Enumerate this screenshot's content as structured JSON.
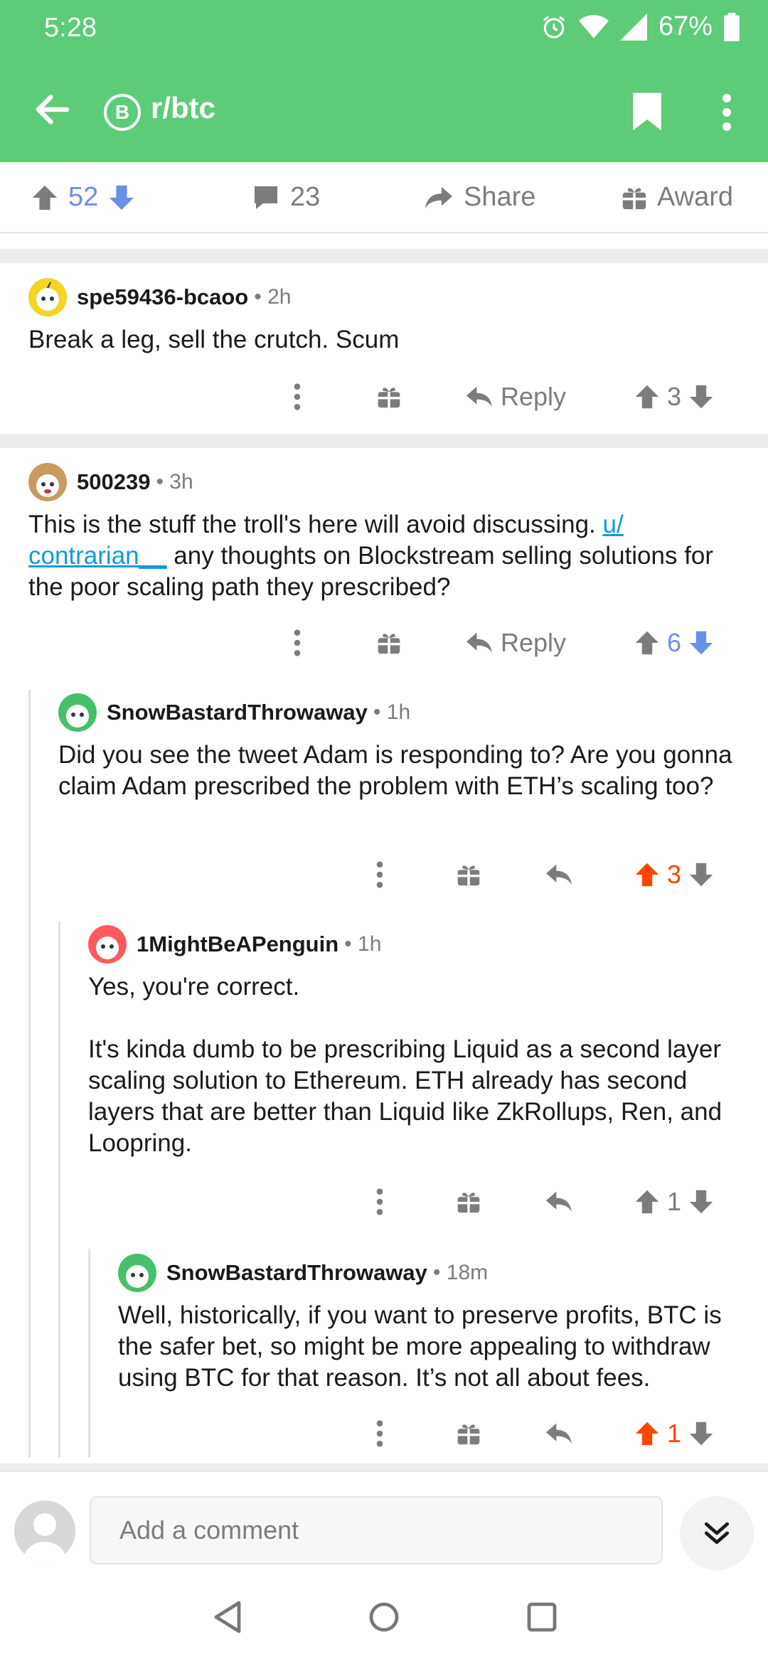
{
  "status_bar": {
    "time": "5:28",
    "battery": "67%"
  },
  "header": {
    "subreddit": "r/btc",
    "subreddit_icon_letter": "B"
  },
  "post_bar": {
    "votes": "52",
    "comments": "23",
    "share": "Share",
    "award": "Award"
  },
  "comments": [
    {
      "author": "spe59436-bcaoo",
      "time": "2h",
      "body": "Break a leg, sell the crutch. Scum",
      "reply_label": "Reply",
      "score": "3"
    },
    {
      "author": "500239",
      "time": "3h",
      "body_prefix": "This is the stuff the troll's here will avoid discussing. ",
      "body_link": "u/ contrarian__",
      "body_suffix": " any thoughts on Blockstream selling solutions for the poor scaling path they prescribed?",
      "reply_label": "Reply",
      "score": "6"
    },
    {
      "author": "SnowBastardThrowaway",
      "time": "1h",
      "body": "Did you see the tweet Adam is responding to? Are you gonna claim Adam prescribed the problem with ETH’s scaling too?",
      "score": "3"
    },
    {
      "author": "1MightBeAPenguin",
      "time": "1h",
      "body_p1": "Yes, you're correct.",
      "body_p2": "It's kinda dumb to be prescribing Liquid as a second layer scaling solution to Ethereum. ETH already has second layers that are better than Liquid like ZkRollups, Ren, and Loopring.",
      "score": "1"
    },
    {
      "author": "SnowBastardThrowaway",
      "time": "18m",
      "body": "Well, historically, if you want to preserve profits, BTC is the safer bet, so might be more appealing to withdraw using BTC for that reason. It’s not all about fees.",
      "score": "1"
    }
  ],
  "composer": {
    "placeholder": "Add a comment"
  },
  "colors": {
    "header": "#5ecb77",
    "upvote": "#ff4500",
    "downvote": "#6a8fe8",
    "link": "#0f9bd7"
  }
}
